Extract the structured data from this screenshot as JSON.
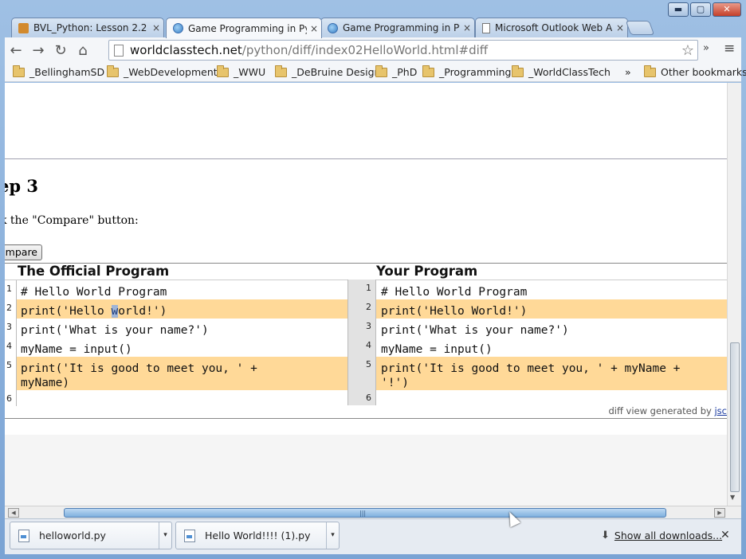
{
  "window": {
    "minimize": "▬",
    "maximize": "▢",
    "close": "✕"
  },
  "tabs": [
    {
      "label": "BVL_Python: Lesson 2.2 - ·",
      "icon": "moodle-icon",
      "close": "×"
    },
    {
      "label": "Game Programming in Py",
      "icon": "globe-icon",
      "close": "×",
      "active": true
    },
    {
      "label": "Game Programming in Py",
      "icon": "globe-icon",
      "close": "×"
    },
    {
      "label": "Microsoft Outlook Web A",
      "icon": "page-icon",
      "close": "×"
    }
  ],
  "toolbar": {
    "back": "←",
    "forward": "→",
    "reload": "↻",
    "home": "⌂",
    "url_host": "worldclasstech.net",
    "url_path": "/python/diff/index02HelloWorld.html#diff",
    "star": "☆",
    "overflow": "»",
    "menu": "≡"
  },
  "bookmarks": {
    "items": [
      "_BellinghamSD",
      "_WebDevelopment",
      "_WWU",
      "_DeBruine Design",
      "_PhD",
      "_Programming",
      "_WorldClassTech"
    ],
    "overflow": "»",
    "other": "Other bookmarks"
  },
  "page": {
    "step_heading": "ep 3",
    "instruction": "k the \"Compare\" button:",
    "compare_button": "mpare",
    "left_title": "The Official Program",
    "right_title": "Your Program",
    "left_lines": [
      "# Hello World Program",
      "print('Hello ",
      "print('What is your name?')",
      "myName = input()",
      "print('It is good to meet you, ' +",
      "myName)"
    ],
    "left_sel_char": "w",
    "left_line2_rest": "orld!')",
    "right_lines": [
      "# Hello World Program",
      "print('Hello World!')",
      "print('What is your name?')",
      "myName = input()",
      "print('It is good to meet you, ' + myName +",
      "'!')"
    ],
    "line_numbers": [
      "1",
      "2",
      "3",
      "4",
      "5",
      "6"
    ],
    "footer_text": "diff view generated by ",
    "footer_link": "jsc"
  },
  "downloads": [
    {
      "name": "helloworld.py",
      "arrow": "▾"
    },
    {
      "name": "Hello World!!!! (1).py",
      "arrow": "▾"
    }
  ],
  "download_bar": {
    "show_all": "Show all downloads...",
    "close": "✕"
  },
  "colors": {
    "diff_highlight": "#ffd998",
    "accent": "#7aa3d4"
  }
}
